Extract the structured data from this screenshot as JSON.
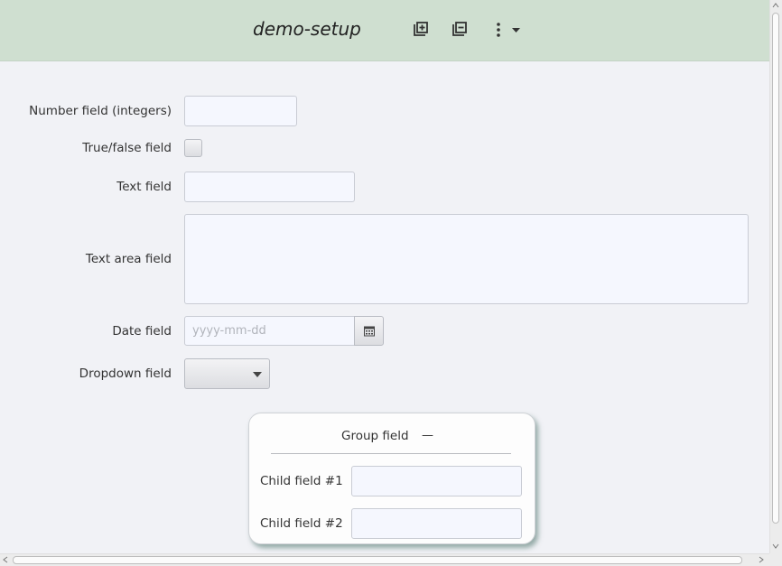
{
  "header": {
    "title": "demo-setup",
    "icons": [
      "copy-plus-icon",
      "copy-minus-icon",
      "more-vertical-icon",
      "caret-down-icon"
    ]
  },
  "form": {
    "number_field": {
      "label": "Number field (integers)",
      "value": ""
    },
    "boolean_field": {
      "label": "True/false field",
      "checked": false
    },
    "text_field": {
      "label": "Text field",
      "value": ""
    },
    "textarea_field": {
      "label": "Text area field",
      "value": ""
    },
    "date_field": {
      "label": "Date field",
      "value": "",
      "placeholder": "yyyy-mm-dd"
    },
    "dropdown_field": {
      "label": "Dropdown field",
      "selected": ""
    }
  },
  "group": {
    "title": "Group field",
    "collapse_symbol": "—",
    "children": [
      {
        "label": "Child field #1",
        "value": ""
      },
      {
        "label": "Child field #2",
        "value": ""
      }
    ]
  },
  "colors": {
    "header_bg": "#cfdfd0",
    "page_bg": "#f1f2f6",
    "input_bg": "#f5f7fe",
    "group_shadow": "#466e64"
  }
}
